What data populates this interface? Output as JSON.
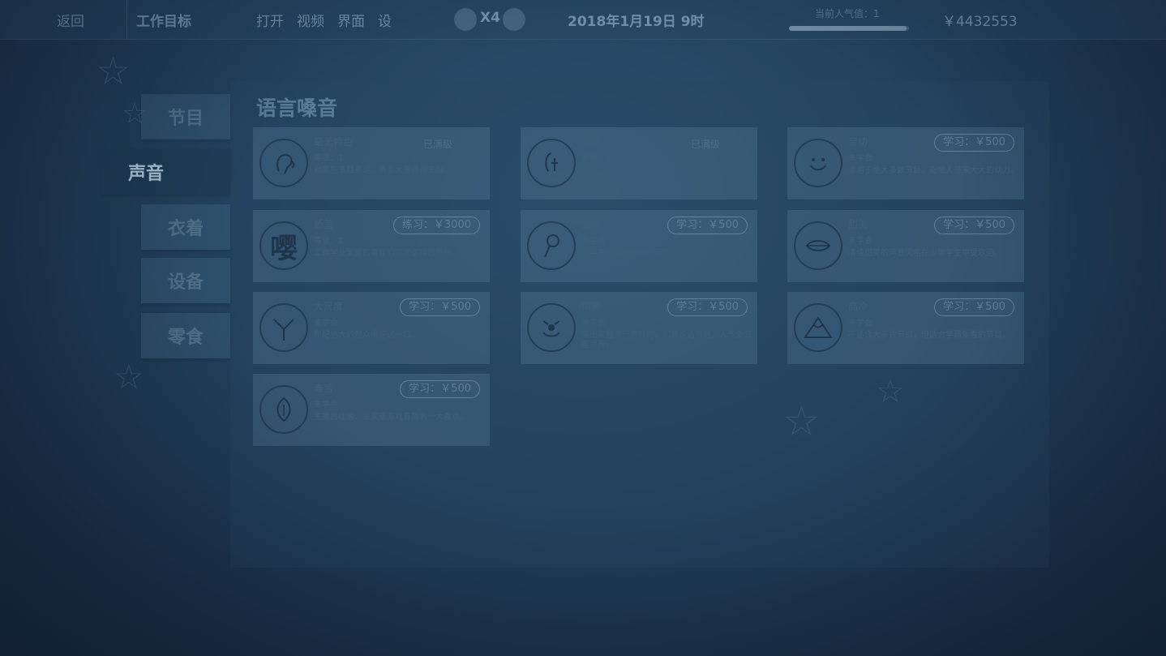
{
  "topbar": {
    "home": "返回",
    "goal": "工作目标",
    "menu": [
      "打开",
      "视频",
      "界面",
      "设"
    ],
    "speed": "X4",
    "date": "2018年1月19日  9时",
    "fans_label": "当前人气值：1",
    "fans_progress": 0.98,
    "money": "￥4432553"
  },
  "sidebar": {
    "tabs": [
      {
        "label": "节目"
      },
      {
        "label": "声音"
      },
      {
        "label": "衣着"
      },
      {
        "label": "设备"
      },
      {
        "label": "零食"
      }
    ]
  },
  "panel": {
    "title": "语言嗓音",
    "cards": [
      {
        "name": "毫无特色",
        "level": "等级：1",
        "desc": "对某些节目来说，声音太普通很无聊。",
        "status": "已满级",
        "icon": "ear-icon"
      },
      {
        "name": "沉默",
        "level": "等级：1",
        "desc": "——",
        "status": "已满级",
        "icon": "silence-icon"
      },
      {
        "name": "亲切",
        "level": "未学会",
        "desc": "适用于绝大多数节目，能给人带来大大的动力。",
        "price": "学习：￥500",
        "icon": "smile-icon"
      },
      {
        "name": "娇羞",
        "level": "等级：2",
        "desc": "工作学业繁重的青年们喜欢这样的风格。",
        "price": "练习：￥3000",
        "icon": "ying-icon",
        "glyph": "嘤"
      },
      {
        "name": "童真",
        "level": "未学会",
        "desc": "小学生们会感觉特别亲切。",
        "price": "学习：￥500",
        "icon": "lollipop-icon"
      },
      {
        "name": "甜美",
        "level": "未学会",
        "desc": "清纯甜美的声音风格在少年学生中受欢迎。",
        "price": "学习：￥500",
        "icon": "lips-icon"
      },
      {
        "name": "大尺度",
        "level": "未学会",
        "desc": "年纪稍大的观众很好这一口。",
        "price": "学习：￥500",
        "icon": "y-icon"
      },
      {
        "name": "搞笑",
        "level": "未学会",
        "desc": "搞出某些流行游戏时，如果说话有趣，人气会显著提升。",
        "price": "学习：￥500",
        "icon": "clown-icon"
      },
      {
        "name": "高冷",
        "level": "未学会",
        "desc": "不适合大多数节目，但适合学霸爱看的节目。",
        "price": "学习：￥500",
        "icon": "mountain-icon"
      },
      {
        "name": "毒舌",
        "level": "未学会",
        "desc": "主播的吐槽，是某些游戏直播的一大看点。",
        "price": "学习：￥500",
        "icon": "tongue-icon"
      }
    ]
  }
}
